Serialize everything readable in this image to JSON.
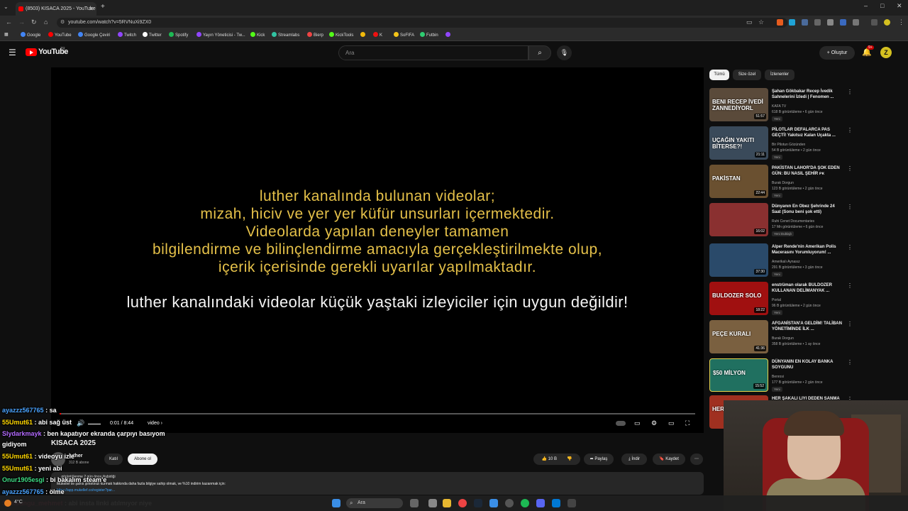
{
  "browser": {
    "tab_title": "(8503) KISACA 2025 - YouTube",
    "url": "youtube.com/watch?v=5RVNuXi9ZX0",
    "bookmarks": [
      {
        "label": "Google",
        "color": "#4285f4"
      },
      {
        "label": "YouTube",
        "color": "#ff0000"
      },
      {
        "label": "Google Çeviri",
        "color": "#4285f4"
      },
      {
        "label": "Twitch",
        "color": "#9146ff"
      },
      {
        "label": "Twitter",
        "color": "#ffffff"
      },
      {
        "label": "Spotify",
        "color": "#1db954"
      },
      {
        "label": "Yayın Yöneticisi - Tw...",
        "color": "#9146ff"
      },
      {
        "label": "Kick",
        "color": "#53fc18"
      },
      {
        "label": "Streamlabs",
        "color": "#31c3a2"
      },
      {
        "label": "Bierp",
        "color": "#e44"
      },
      {
        "label": "KickTools",
        "color": "#53fc18"
      },
      {
        "label": "",
        "color": "#f0b90b"
      },
      {
        "label": "K",
        "color": "#e11"
      },
      {
        "label": "SoFIFA",
        "color": "#f5c518"
      },
      {
        "label": "Futbin",
        "color": "#2ecc71"
      },
      {
        "label": "",
        "color": "#9146ff"
      }
    ]
  },
  "header": {
    "logo": "YouTube",
    "logo_region": "TR",
    "search_placeholder": "Ara",
    "create_label": "Oluştur",
    "notif_count": "9+",
    "avatar_letter": "Z"
  },
  "player": {
    "disclaimer_lines": [
      "luther kanalında bulunan videolar;",
      "mizah, hiciv ve yer yer küfür unsurları içermektedir.",
      "Videolarda yapılan deneyler tamamen",
      "bilgilendirme ve bilinçlendirme amacıyla gerçekleştirilmekte olup,",
      "içerik içerisinde gerekli uyarılar yapılmaktadır."
    ],
    "warning": "luther kanalındaki videolar küçük yaştaki izleyiciler için uygun değildir!",
    "time": "0:01 / 8:44",
    "chapter": "video",
    "progress": 0.002
  },
  "video": {
    "title": "KISACA 2025",
    "channel": "luther",
    "subs": "312 B abone",
    "join_label": "Katıl",
    "subscribe_label": "Abone ol",
    "likes": "10 B",
    "share_label": "Paylaş",
    "download_label": "İndir",
    "save_label": "Kaydet",
    "desc_meta": "… görüntülenme  2 gün önce  #işbirliği",
    "desc_text": "Mükellef ile şahıs şirketinizi kurmak hakkında daha fazla bilgiye sahip olmak, ve %10 indirim kazanmak için:",
    "desc_link": "https://app.mukellef.co/register?par..."
  },
  "sidebar": {
    "chips": [
      "Tümü",
      "Size özel",
      "İzlenenler"
    ],
    "items": [
      {
        "title": "Şahan Gökbakar Recep İvedik Sahnelerini İzledi | Fenomen ...",
        "channel": "KAFA TV",
        "meta": "618 B görüntüleme • 6 gün önce",
        "badge": "Yeni",
        "duration": "51:57",
        "thumb_text": "BENI RECEP İVEDİ ZANNEDİYORL",
        "color": "#5a4a3a"
      },
      {
        "title": "PİLOTLAR DEFALARCA PAS GEÇTİ! Yakıtsız Kalan Uçakta ...",
        "channel": "Bir Pilotun Gözünden",
        "meta": "54 B görüntüleme • 2 gün önce",
        "badge": "Yeni",
        "duration": "21:11",
        "thumb_text": "UÇAĞIN YAKITI BİTERSE?!",
        "color": "#3a4a5a"
      },
      {
        "title": "PAKİSTAN LAHOR'DA ŞOK EDEN GÜN: BU NASIL ŞEHİR ᴘᴋ",
        "channel": "Burak Dorgun",
        "meta": "123 B görüntüleme • 2 gün önce",
        "badge": "Yeni",
        "duration": "22:44",
        "thumb_text": "PAKİSTAN",
        "color": "#6a5030"
      },
      {
        "title": "Dünyanın En Obez Şehrinde 24 Saat (Sonu beni şok etti)",
        "channel": "Ruhi Cenet Documentaries",
        "meta": "17 Mn görüntüleme • 6 gün önce",
        "badge": "Yeni   Dublajlı",
        "duration": "16:02",
        "thumb_text": "",
        "color": "#8a3030"
      },
      {
        "title": "Alper Rende'nin Amerikan Polis Macerasını Yorumluyorum! ...",
        "channel": "Amerikalı Aynasız",
        "meta": "291 B görüntüleme • 3 gün önce",
        "badge": "Yeni",
        "duration": "37:30",
        "thumb_text": "",
        "color": "#2a4a6a"
      },
      {
        "title": "enstrüman olarak BULDOZER KULLANAN DELİMANYAK ...",
        "channel": "Portal",
        "meta": "96 B görüntüleme • 2 gün önce",
        "badge": "Yeni",
        "duration": "18:22",
        "thumb_text": "BULDOZER SOLO",
        "color": "#a01010"
      },
      {
        "title": "AFGANİSTAN'A GELDİM! TALİBAN YÖNETİMİNDE İLK ...",
        "channel": "Burak Dorgun",
        "meta": "358 B görüntüleme • 1 ay önce",
        "badge": "",
        "duration": "41:36",
        "thumb_text": "PEÇE KURALI",
        "color": "#7a6040"
      },
      {
        "title": "DÜNYANIN EN KOLAY BANKA SOYGUNU",
        "channel": "Benrosi",
        "meta": "177 B görüntüleme • 2 gün önce",
        "badge": "Yeni",
        "duration": "15:52",
        "thumb_text": "$50 MİLYON",
        "color": "#207060"
      },
      {
        "title": "HER ŞAKALI LIYI DEDEN SANMA",
        "channel": "",
        "meta": "",
        "badge": "",
        "duration": "",
        "thumb_text": "HER",
        "color": "#a03020"
      }
    ]
  },
  "chat": [
    {
      "user": "ayazzz567765",
      "msg": "sa",
      "color": "#4aa3ff"
    },
    {
      "user": "55Umut61",
      "msg": "abi sağ üst",
      "color": "#ffd700"
    },
    {
      "user": "Slydarkmayk",
      "msg": "ben kapatıyor ekranda çarpıyı basıyom",
      "color": "#b46bff"
    },
    {
      "user": "",
      "msg": "gidiyom",
      "color": "#b46bff"
    },
    {
      "user": "55Umut61",
      "msg": "videoyu izle",
      "color": "#ffd700"
    },
    {
      "user": "55Umut61",
      "msg": "yeni abi",
      "color": "#ffd700"
    },
    {
      "user": "Onur1905esgi",
      "msg": "bi bakalım steam'e",
      "color": "#3ddc84"
    },
    {
      "user": "ayazzz567765",
      "msg": "ölme",
      "color": "#4aa3ff"
    },
    {
      "user": "Samsungu_mehmet",
      "msg": "abi insta linki atılmıyor niye",
      "color": "#ff3b6b"
    }
  ],
  "taskbar": {
    "search_label": "Ara",
    "weather": "4°C"
  }
}
